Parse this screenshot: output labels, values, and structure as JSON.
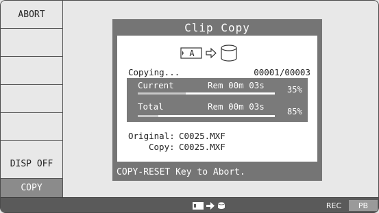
{
  "sidebar": {
    "items": [
      {
        "label": "ABORT"
      },
      {
        "label": ""
      },
      {
        "label": ""
      },
      {
        "label": ""
      },
      {
        "label": ""
      },
      {
        "label": "DISP OFF"
      },
      {
        "label": "COPY"
      }
    ]
  },
  "dialog": {
    "title": "Clip Copy",
    "card_label": "A",
    "status_label": "Copying...",
    "counter": "00001/00003",
    "current": {
      "label": "Current",
      "rem": "Rem 00m 03s",
      "percent_label": "35%",
      "percent": 35
    },
    "total": {
      "label": "Total",
      "rem": "Rem 00m 03s",
      "percent_label": "85%",
      "percent": 85
    },
    "original_label": "Original:",
    "original_value": "C0025.MXF",
    "copy_label": "Copy:",
    "copy_value": "C0025.MXF",
    "footer": "COPY-RESET Key to Abort."
  },
  "statusbar": {
    "rec_label": "REC",
    "pb_label": "PB"
  },
  "icons": {
    "card": "memory-card-icon",
    "arrow": "arrow-right-icon",
    "disk": "disk-icon"
  }
}
